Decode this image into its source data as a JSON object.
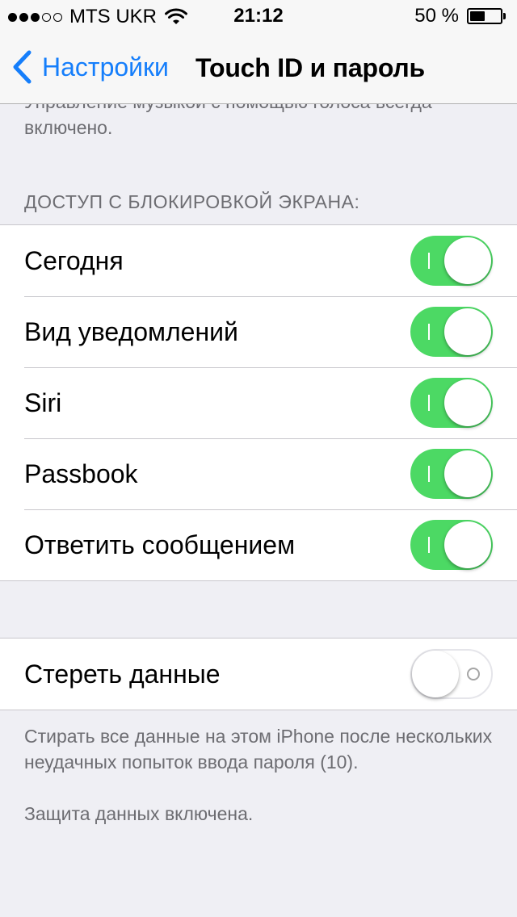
{
  "status_bar": {
    "signal_filled": 3,
    "signal_total": 5,
    "carrier": "MTS UKR",
    "wifi_icon": "wifi-icon",
    "time": "21:12",
    "battery_text": "50 %",
    "battery_level": 0.5
  },
  "nav": {
    "back_label": "Настройки",
    "back_icon": "chevron-left-icon",
    "title": "Touch ID и пароль",
    "accent_color": "#157efb"
  },
  "top_footnote": "Управление музыкой с помощью голоса всегда включено.",
  "lock_section": {
    "header": "ДОСТУП С БЛОКИРОВКОЙ ЭКРАНА:",
    "items": [
      {
        "label": "Сегодня",
        "on": true
      },
      {
        "label": "Вид уведомлений",
        "on": true
      },
      {
        "label": "Siri",
        "on": true
      },
      {
        "label": "Passbook",
        "on": true
      },
      {
        "label": "Ответить сообщением",
        "on": true
      }
    ]
  },
  "erase_section": {
    "label": "Стереть данные",
    "on": false,
    "footnote": "Стирать все данные на этом iPhone после нескольких неудачных попыток ввода пароля (10).",
    "protection_note": "Защита данных включена."
  },
  "colors": {
    "switch_on": "#4cd964",
    "background": "#efeff4"
  }
}
